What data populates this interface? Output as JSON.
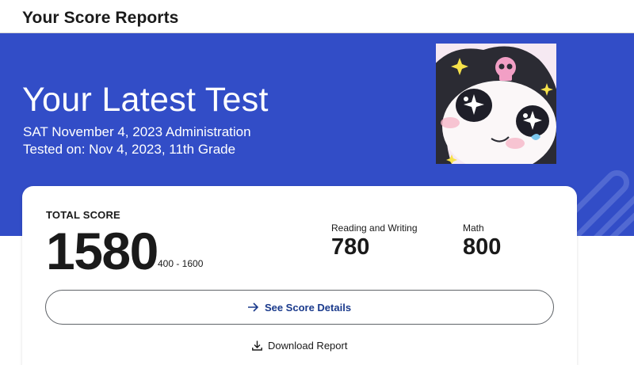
{
  "header": {
    "title": "Your Score Reports"
  },
  "hero": {
    "title": "Your Latest Test",
    "administration": "SAT November 4, 2023 Administration",
    "tested_on": "Tested on: Nov 4, 2023, 11th Grade",
    "background_color": "#324dc7"
  },
  "score_card": {
    "total_label": "TOTAL SCORE",
    "total_score": "1580",
    "score_range": "400 - 1600",
    "sections": [
      {
        "label": "Reading and Writing",
        "score": "780"
      },
      {
        "label": "Math",
        "score": "800"
      }
    ],
    "details_button": {
      "label": "See Score Details",
      "icon": "arrow-right-icon"
    },
    "download_link": {
      "label": "Download Report",
      "icon": "download-icon"
    }
  }
}
